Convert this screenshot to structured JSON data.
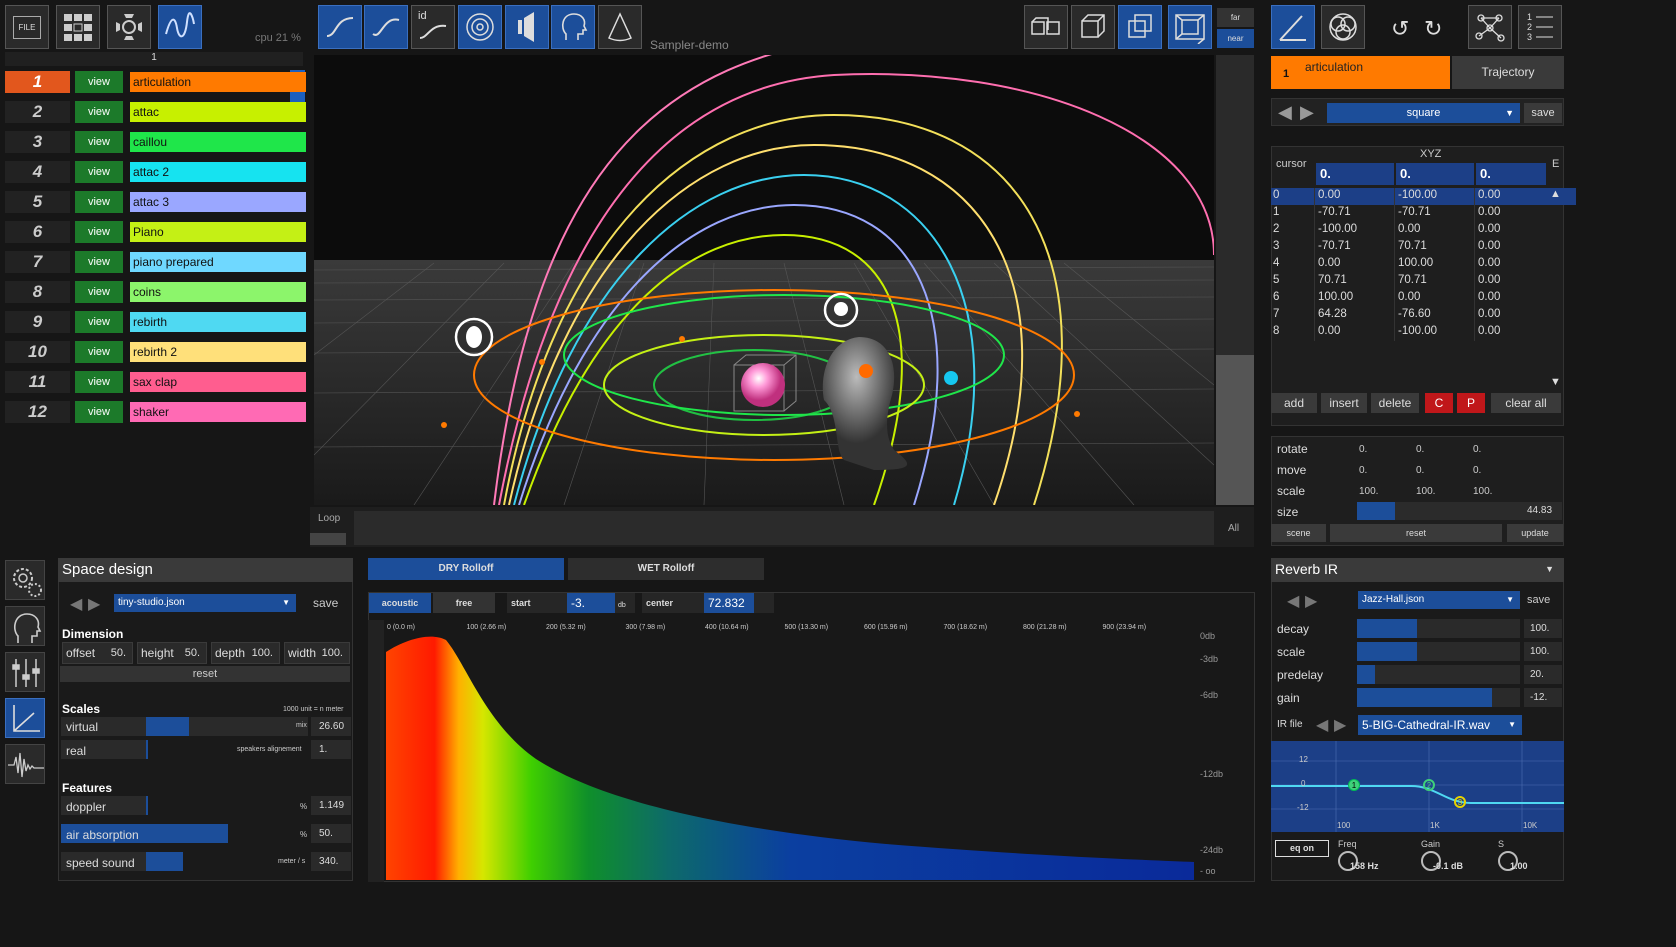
{
  "toolbar": {
    "file_label": "FILE",
    "cpu": "cpu 21 %",
    "sampler": "Sampler-demo",
    "far": "far",
    "near": "near",
    "view_id_label": "id"
  },
  "tracks_header": "1",
  "tracks": [
    {
      "num": "1",
      "name": "articulation",
      "color": "#ff7a00",
      "view": "view"
    },
    {
      "num": "2",
      "name": "attac",
      "color": "#c7f000",
      "view": "view"
    },
    {
      "num": "3",
      "name": "caillou",
      "color": "#1fe64a",
      "view": "view"
    },
    {
      "num": "4",
      "name": "attac 2",
      "color": "#16e3f0",
      "view": "view"
    },
    {
      "num": "5",
      "name": "attac 3",
      "color": "#9aa7ff",
      "view": "view"
    },
    {
      "num": "6",
      "name": "Piano",
      "color": "#c4f015",
      "view": "view"
    },
    {
      "num": "7",
      "name": "piano prepared",
      "color": "#6fd8ff",
      "view": "view"
    },
    {
      "num": "8",
      "name": "coins",
      "color": "#8cf56b",
      "view": "view"
    },
    {
      "num": "9",
      "name": "rebirth",
      "color": "#4fd9f2",
      "view": "view"
    },
    {
      "num": "10",
      "name": "rebirth 2",
      "color": "#ffe07a",
      "view": "view"
    },
    {
      "num": "11",
      "name": "sax clap",
      "color": "#ff5d8f",
      "view": "view"
    },
    {
      "num": "12",
      "name": "shaker",
      "color": "#ff6ab4",
      "view": "view"
    }
  ],
  "viewport": {
    "loop": "Loop",
    "all": "All"
  },
  "right": {
    "track_num": "1",
    "track_name": "articulation",
    "trajectory_tab": "Trajectory",
    "shape": "square",
    "save": "save",
    "cursor": "cursor",
    "xyz": "XYZ",
    "e": "E",
    "head_values": [
      "0.",
      "0.",
      "0."
    ],
    "rows": [
      [
        "0",
        "0.00",
        "-100.00",
        "0.00"
      ],
      [
        "1",
        "-70.71",
        "-70.71",
        "0.00"
      ],
      [
        "2",
        "-100.00",
        "0.00",
        "0.00"
      ],
      [
        "3",
        "-70.71",
        "70.71",
        "0.00"
      ],
      [
        "4",
        "0.00",
        "100.00",
        "0.00"
      ],
      [
        "5",
        "70.71",
        "70.71",
        "0.00"
      ],
      [
        "6",
        "100.00",
        "0.00",
        "0.00"
      ],
      [
        "7",
        "64.28",
        "-76.60",
        "0.00"
      ],
      [
        "8",
        "0.00",
        "-100.00",
        "0.00"
      ]
    ],
    "btn_add": "add",
    "btn_insert": "insert",
    "btn_delete": "delete",
    "btn_c": "C",
    "btn_p": "P",
    "btn_clear": "clear all",
    "transform": [
      {
        "label": "rotate",
        "v": [
          "0.",
          "0.",
          "0."
        ]
      },
      {
        "label": "move",
        "v": [
          "0.",
          "0.",
          "0."
        ]
      },
      {
        "label": "scale",
        "v": [
          "100.",
          "100.",
          "100."
        ]
      }
    ],
    "size_label": "size",
    "size_value": "44.83",
    "scene": "scene",
    "reset": "reset",
    "update": "update"
  },
  "space": {
    "title": "Space design",
    "file": "tiny-studio.json",
    "save": "save",
    "dimension": "Dimension",
    "dims": [
      {
        "label": "offset",
        "value": "50."
      },
      {
        "label": "height",
        "value": "50."
      },
      {
        "label": "depth",
        "value": "100."
      },
      {
        "label": "width",
        "value": "100."
      }
    ],
    "reset": "reset",
    "scales": "Scales",
    "unit_note": "1000 unit = n meter",
    "virtual": "virtual",
    "mix": "mix",
    "mix_val": "26.60",
    "real": "real",
    "speakers": "speakers alignement",
    "speakers_val": "1.",
    "features": "Features",
    "doppler": "doppler",
    "pct": "%",
    "doppler_val": "1.149",
    "air": "air absorption",
    "air_val": "50.",
    "speed": "speed sound",
    "speed_unit": "meter / s",
    "speed_val": "340."
  },
  "rolloff": {
    "dry": "DRY Rolloff",
    "wet": "WET Rolloff",
    "acoustic": "acoustic",
    "free": "free",
    "start": "start",
    "start_val": "-3.",
    "db": "db",
    "center": "center",
    "center_val": "72.832",
    "xticks": [
      "0 (0.0 m)",
      "100 (2.66 m)",
      "200 (5.32 m)",
      "300 (7.98 m)",
      "400 (10.64 m)",
      "500 (13.30 m)",
      "600 (15.96 m)",
      "700 (18.62 m)",
      "800 (21.28 m)",
      "900 (23.94 m)"
    ],
    "yticks": [
      "0db",
      "-3db",
      "-6db",
      "-12db",
      "-24db",
      "- oo"
    ]
  },
  "reverb": {
    "title": "Reverb IR",
    "file": "Jazz-Hall.json",
    "save": "save",
    "params": [
      {
        "label": "decay",
        "value": "100.",
        "fill": 0.4
      },
      {
        "label": "scale",
        "value": "100.",
        "fill": 0.4
      },
      {
        "label": "predelay",
        "value": "20.",
        "fill": 0.12
      },
      {
        "label": "gain",
        "value": "-12.",
        "fill": 0.9
      }
    ],
    "ir_label": "IR file",
    "ir_file": "5-BIG-Cathedral-IR.wav",
    "eq_y": [
      "12",
      "0",
      "-12"
    ],
    "eq_x": [
      "100",
      "1K",
      "10K"
    ],
    "eq_on": "eq on",
    "freq_label": "Freq",
    "freq_val": "158 Hz",
    "gain_label": "Gain",
    "gain_val": "-0.1 dB",
    "s_label": "S",
    "s_val": "1.00",
    "nodes": [
      "1",
      "2",
      "3"
    ]
  }
}
